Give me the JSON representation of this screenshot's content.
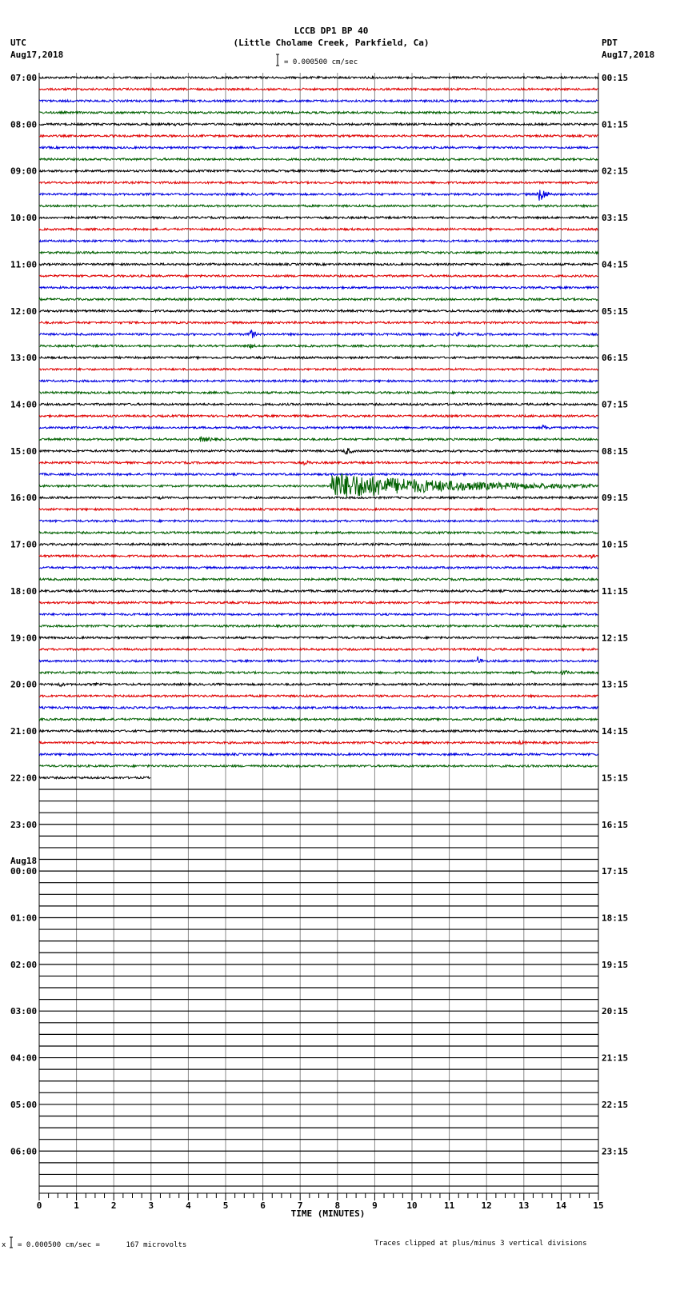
{
  "header": {
    "title": "LCCB DP1 BP 40",
    "subtitle": "(Little Cholame Creek, Parkfield, Ca)",
    "left_tz": "UTC",
    "left_date": "Aug17,2018",
    "right_tz": "PDT",
    "right_date": "Aug17,2018",
    "scale": "= 0.000500 cm/sec"
  },
  "footer": {
    "scale": "= 0.000500 cm/sec =      167 microvolts",
    "scale_prefix": "x",
    "clip_note": "Traces clipped at plus/minus 3 vertical divisions"
  },
  "chart_data": {
    "type": "line",
    "title": "LCCB DP1 BP 40",
    "xlabel": "TIME (MINUTES)",
    "xlim": [
      0,
      15
    ],
    "x_ticks": [
      "0",
      "1",
      "2",
      "3",
      "4",
      "5",
      "6",
      "7",
      "8",
      "9",
      "10",
      "11",
      "12",
      "13",
      "14",
      "15"
    ],
    "rows_total": 96,
    "rows_with_data": 61,
    "last_row_end_minute": 3,
    "trace_colors": [
      "#000000",
      "#e00000",
      "#0000e0",
      "#006000"
    ],
    "left_labels": [
      {
        "row": 0,
        "text": "07:00"
      },
      {
        "row": 4,
        "text": "08:00"
      },
      {
        "row": 8,
        "text": "09:00"
      },
      {
        "row": 12,
        "text": "10:00"
      },
      {
        "row": 16,
        "text": "11:00"
      },
      {
        "row": 20,
        "text": "12:00"
      },
      {
        "row": 24,
        "text": "13:00"
      },
      {
        "row": 28,
        "text": "14:00"
      },
      {
        "row": 32,
        "text": "15:00"
      },
      {
        "row": 36,
        "text": "16:00"
      },
      {
        "row": 40,
        "text": "17:00"
      },
      {
        "row": 44,
        "text": "18:00"
      },
      {
        "row": 48,
        "text": "19:00"
      },
      {
        "row": 52,
        "text": "20:00"
      },
      {
        "row": 56,
        "text": "21:00"
      },
      {
        "row": 60,
        "text": "22:00"
      },
      {
        "row": 64,
        "text": "23:00"
      },
      {
        "row": 68,
        "text": "00:00",
        "above": "Aug18"
      },
      {
        "row": 72,
        "text": "01:00"
      },
      {
        "row": 76,
        "text": "02:00"
      },
      {
        "row": 80,
        "text": "03:00"
      },
      {
        "row": 84,
        "text": "04:00"
      },
      {
        "row": 88,
        "text": "05:00"
      },
      {
        "row": 92,
        "text": "06:00"
      }
    ],
    "right_labels": [
      "00:15",
      "01:15",
      "02:15",
      "03:15",
      "04:15",
      "05:15",
      "06:15",
      "07:15",
      "08:15",
      "09:15",
      "10:15",
      "11:15",
      "12:15",
      "13:15",
      "14:15",
      "15:15",
      "16:15",
      "17:15",
      "18:15",
      "19:15",
      "20:15",
      "21:15",
      "22:15",
      "23:15"
    ],
    "events": [
      {
        "row": 4,
        "minute": 3.6,
        "amp": 3,
        "dur": 0.3
      },
      {
        "row": 4,
        "minute": 7.2,
        "amp": 2,
        "dur": 0.3
      },
      {
        "row": 4,
        "minute": 9.6,
        "amp": 2,
        "dur": 0.3
      },
      {
        "row": 4,
        "minute": 14.8,
        "amp": 3,
        "dur": 0.2
      },
      {
        "row": 10,
        "minute": 13.4,
        "amp": 12,
        "dur": 0.5
      },
      {
        "row": 22,
        "minute": 5.65,
        "amp": 9,
        "dur": 0.3
      },
      {
        "row": 22,
        "minute": 11.2,
        "amp": 4,
        "dur": 0.4
      },
      {
        "row": 22,
        "minute": 12.7,
        "amp": 2,
        "dur": 0.3
      },
      {
        "row": 22,
        "minute": 14.6,
        "amp": 2,
        "dur": 0.2
      },
      {
        "row": 23,
        "minute": 5.6,
        "amp": 4,
        "dur": 0.6
      },
      {
        "row": 30,
        "minute": 13.5,
        "amp": 4,
        "dur": 0.8
      },
      {
        "row": 31,
        "minute": 4.3,
        "amp": 4,
        "dur": 1.5
      },
      {
        "row": 32,
        "minute": 8.2,
        "amp": 6,
        "dur": 0.5
      },
      {
        "row": 32,
        "minute": 10.0,
        "amp": 2,
        "dur": 2
      },
      {
        "row": 33,
        "minute": 7.1,
        "amp": 3,
        "dur": 0.8
      },
      {
        "row": 33,
        "minute": 5.0,
        "amp": 2,
        "dur": 1.5
      },
      {
        "row": 35,
        "minute": 7.85,
        "amp": 14,
        "dur": 7
      },
      {
        "row": 36,
        "minute": 3.2,
        "amp": 3,
        "dur": 0.4
      },
      {
        "row": 41,
        "minute": 14.8,
        "amp": 4,
        "dur": 0.3
      },
      {
        "row": 50,
        "minute": 11.75,
        "amp": 7,
        "dur": 0.3
      },
      {
        "row": 51,
        "minute": 13.2,
        "amp": 3,
        "dur": 0.3
      },
      {
        "row": 51,
        "minute": 14.0,
        "amp": 4,
        "dur": 0.8
      },
      {
        "row": 52,
        "minute": 0.5,
        "amp": 5,
        "dur": 0.4
      },
      {
        "row": 52,
        "minute": 1.5,
        "amp": 3,
        "dur": 0.4
      },
      {
        "row": 57,
        "minute": 12.8,
        "amp": 3,
        "dur": 1
      }
    ]
  }
}
